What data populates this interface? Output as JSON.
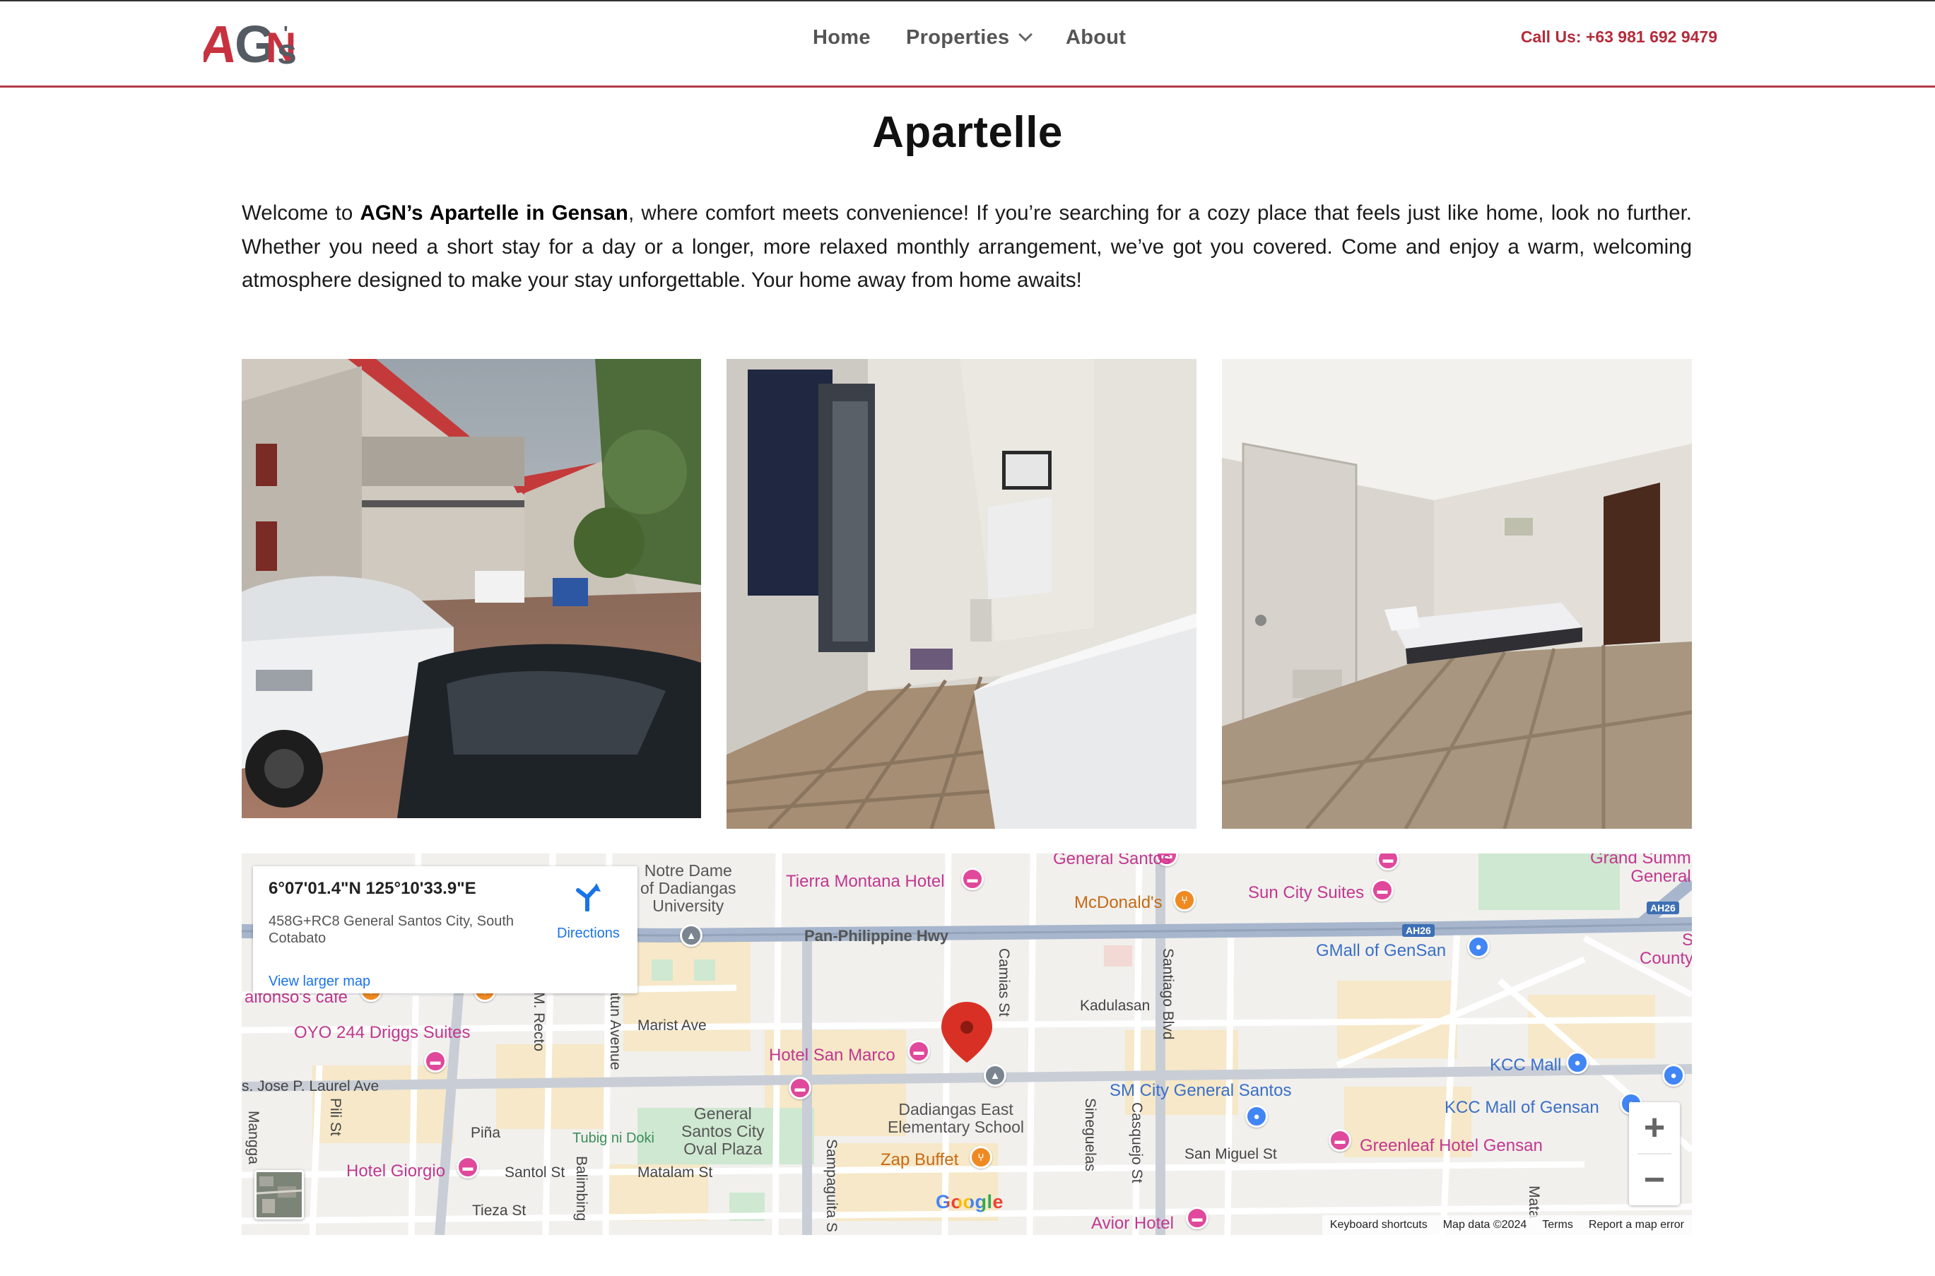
{
  "header": {
    "logo_alt": "AGN's",
    "nav": [
      {
        "label": "Home"
      },
      {
        "label": "Properties"
      },
      {
        "label": "About"
      }
    ],
    "call": "Call Us: +63 981 692 9479"
  },
  "page": {
    "title": "Apartelle",
    "intro_before": "Welcome to ",
    "intro_bold": "AGN’s Apartelle in Gensan",
    "intro_after": ", where comfort meets convenience! If you’re searching for a cozy place that feels just like home, look no further. Whether you need a short stay for a day or a longer, more relaxed monthly arrangement, we’ve got you covered. Come and enjoy a warm, welcoming atmosphere designed to make your stay unforgettable. Your home away from home awaits!"
  },
  "photos": [
    {
      "subject": "building-exterior-photo"
    },
    {
      "subject": "room-entrance-photo"
    },
    {
      "subject": "bedroom-photo"
    }
  ],
  "map": {
    "coords": "6°07'01.4\"N 125°10'33.9\"E",
    "address": "458G+RC8 General Santos City, South Cotabato",
    "directions": "Directions",
    "view_larger": "View larger map",
    "google": "Google",
    "attribution": {
      "shortcuts": "Keyboard shortcuts",
      "data": "Map data ©2024",
      "terms": "Terms",
      "report": "Report a map error"
    },
    "highway_shield": "AH26",
    "labels": {
      "notre_dame": "Notre Dame\nof Dadiangas\nUniversity",
      "tierra": "Tierra Montana Hotel",
      "general_santos_top": "General Santos",
      "mcdonalds": "McDonald's",
      "sun_city": "Sun City Suites",
      "grand_summ": "Grand Summ\nGeneral",
      "pan_phil": "Pan-Philippine Hwy",
      "gmall": "GMall of GenSan",
      "county": "S\nCounty",
      "camias": "Camias St",
      "santiago": "Santiago Blvd",
      "kadulasan": "Kadulasan",
      "alfonsos": "alfonso's cafe",
      "oyo": "OYO 244 Driggs Suites",
      "m_recto": "M. Recto",
      "atun": "atun Avenue",
      "marist": "Marist Ave",
      "hotel_san_marco": "Hotel San Marco",
      "kcc_mall": "KCC Mall",
      "jose_laurel": "s. Jose P. Laurel Ave",
      "dadiangas_east": "Dadiangas East\nElementary School",
      "sm_city": "SM City General Santos",
      "kcc_gensan": "KCC Mall of Gensan",
      "mangga": "Mangga",
      "pili": "Pili St",
      "pina": "Piña",
      "tubig": "Tubig ni Doki",
      "oval_plaza": "General\nSantos City\nOval Plaza",
      "sampaguita": "Sampaguita S",
      "zap": "Zap Buffet",
      "sineguelas": "Sineguelas",
      "casquejo": "Casquejo St",
      "san_miguel": "San Miguel St",
      "greenleaf": "Greenleaf Hotel Gensan",
      "hotel_giorgio": "Hotel Giorgio",
      "santol": "Santol St",
      "balimbing": "Balimbing",
      "matalam": "Matalam St",
      "tieza": "Tieza St",
      "avior": "Avior Hotel",
      "mata": "Mata"
    }
  }
}
